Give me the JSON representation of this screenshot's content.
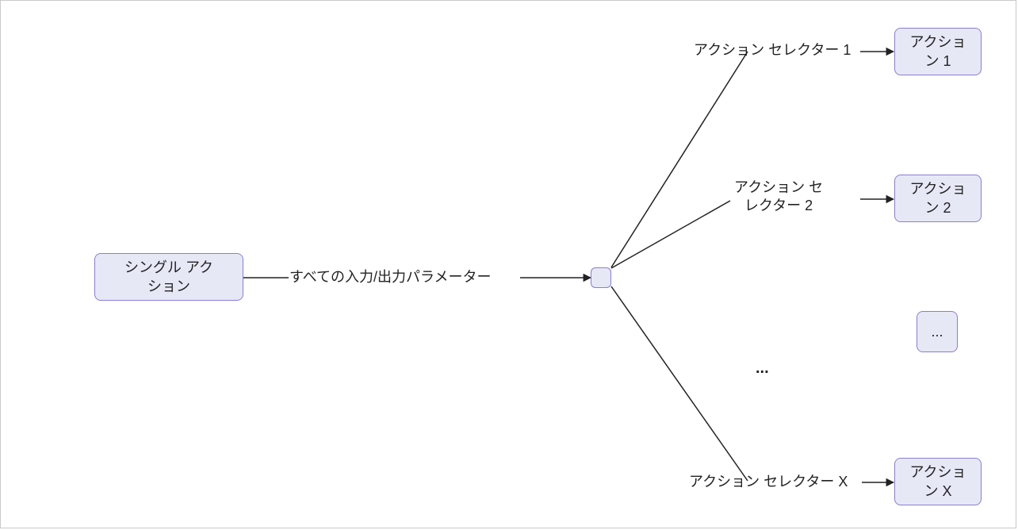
{
  "nodes": {
    "single_action": "シングル アク\nション",
    "action_1": "アクショ\nン 1",
    "action_2": "アクショ\nン 2",
    "action_dots": "...",
    "action_x": "アクショ\nン X"
  },
  "labels": {
    "all_params": "すべての入力/出力パラメーター",
    "selector_1": "アクション セレクター 1",
    "selector_2": "アクション セ\nレクター 2",
    "selector_x": "アクション セレクター X"
  },
  "ellipsis": "..."
}
